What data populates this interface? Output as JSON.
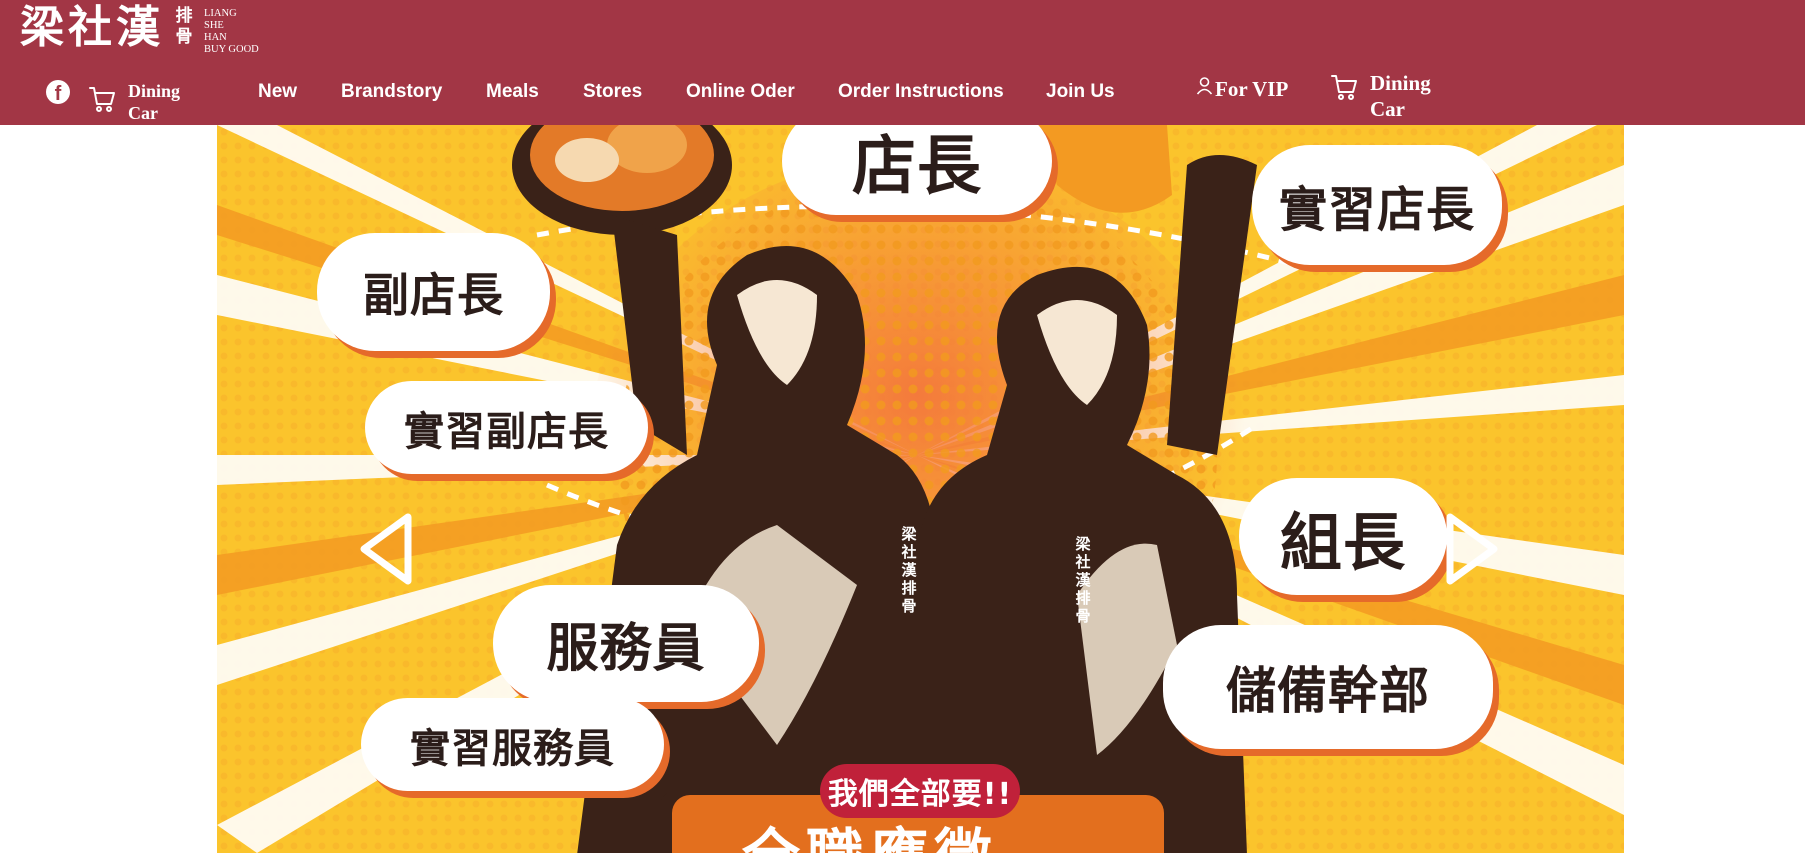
{
  "brand": {
    "logo_main": "梁社漢",
    "logo_seal": "排骨",
    "logo_sub_lines": [
      "LIANG",
      "SHE",
      "HAN",
      "BUY GOOD"
    ]
  },
  "header": {
    "background": "#a23645",
    "facebook_icon": "facebook-icon",
    "cart_small_label": "Dining Car",
    "nav": [
      "New",
      "Brandstory",
      "Meals",
      "Stores",
      "Online Oder",
      "Order Instructions",
      "Join Us"
    ],
    "vip_label": "For VIP",
    "cart_big_label": "Dining Car"
  },
  "banner": {
    "bubbles": {
      "store_manager": "店長",
      "intern_store_manager": "實習店長",
      "assistant_manager": "副店長",
      "intern_assistant_manager": "實習副店長",
      "team_leader": "組長",
      "server": "服務員",
      "intern_server": "實習服務員",
      "management_trainee": "儲備幹部"
    },
    "cta_tag": "我們全部要!!",
    "cta_title": "全職應徵",
    "shirt_logo": "梁社漢排骨",
    "prev_icon": "chevron-left-icon",
    "next_icon": "chevron-right-icon",
    "colors": {
      "yellow": "#fbc42c",
      "orange": "#e36f1e",
      "brown": "#3a2218",
      "red": "#c0213a"
    }
  }
}
